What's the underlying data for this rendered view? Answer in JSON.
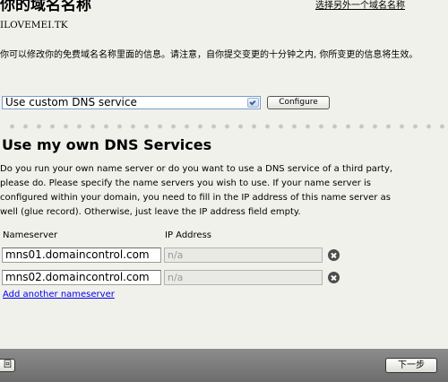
{
  "header": {
    "title": "你的域名名称",
    "switch_link": "选择另外一个域名名称",
    "domain": "ILOVEMEI.TK"
  },
  "intro": {
    "text": "你可以修改你的免费域名名称里面的信息。请注意，自你提交变更的十分钟之内, 你所变更的信息将生效。"
  },
  "dns": {
    "selected": "Use custom DNS service",
    "configure_label": "Configure"
  },
  "section": {
    "title": "Use my own DNS Services",
    "text": "Do you run your own name server or do you want to use a DNS service of a third party, please do. Please specify the name servers you wish to use. If your name server is configured within your domain, you need to fill in the IP address of this name server as well (glue record). Otherwise, just leave the IP address field empty."
  },
  "nameservers": {
    "col_nameserver": "Nameserver",
    "col_ip": "IP Address",
    "rows": [
      {
        "nameserver": "mns01.domaincontrol.com",
        "ip": "n/a"
      },
      {
        "nameserver": "mns02.domaincontrol.com",
        "ip": "n/a"
      }
    ],
    "add_label": "Add another nameserver"
  },
  "footer": {
    "back_label": "回",
    "next_label": "下一步"
  }
}
